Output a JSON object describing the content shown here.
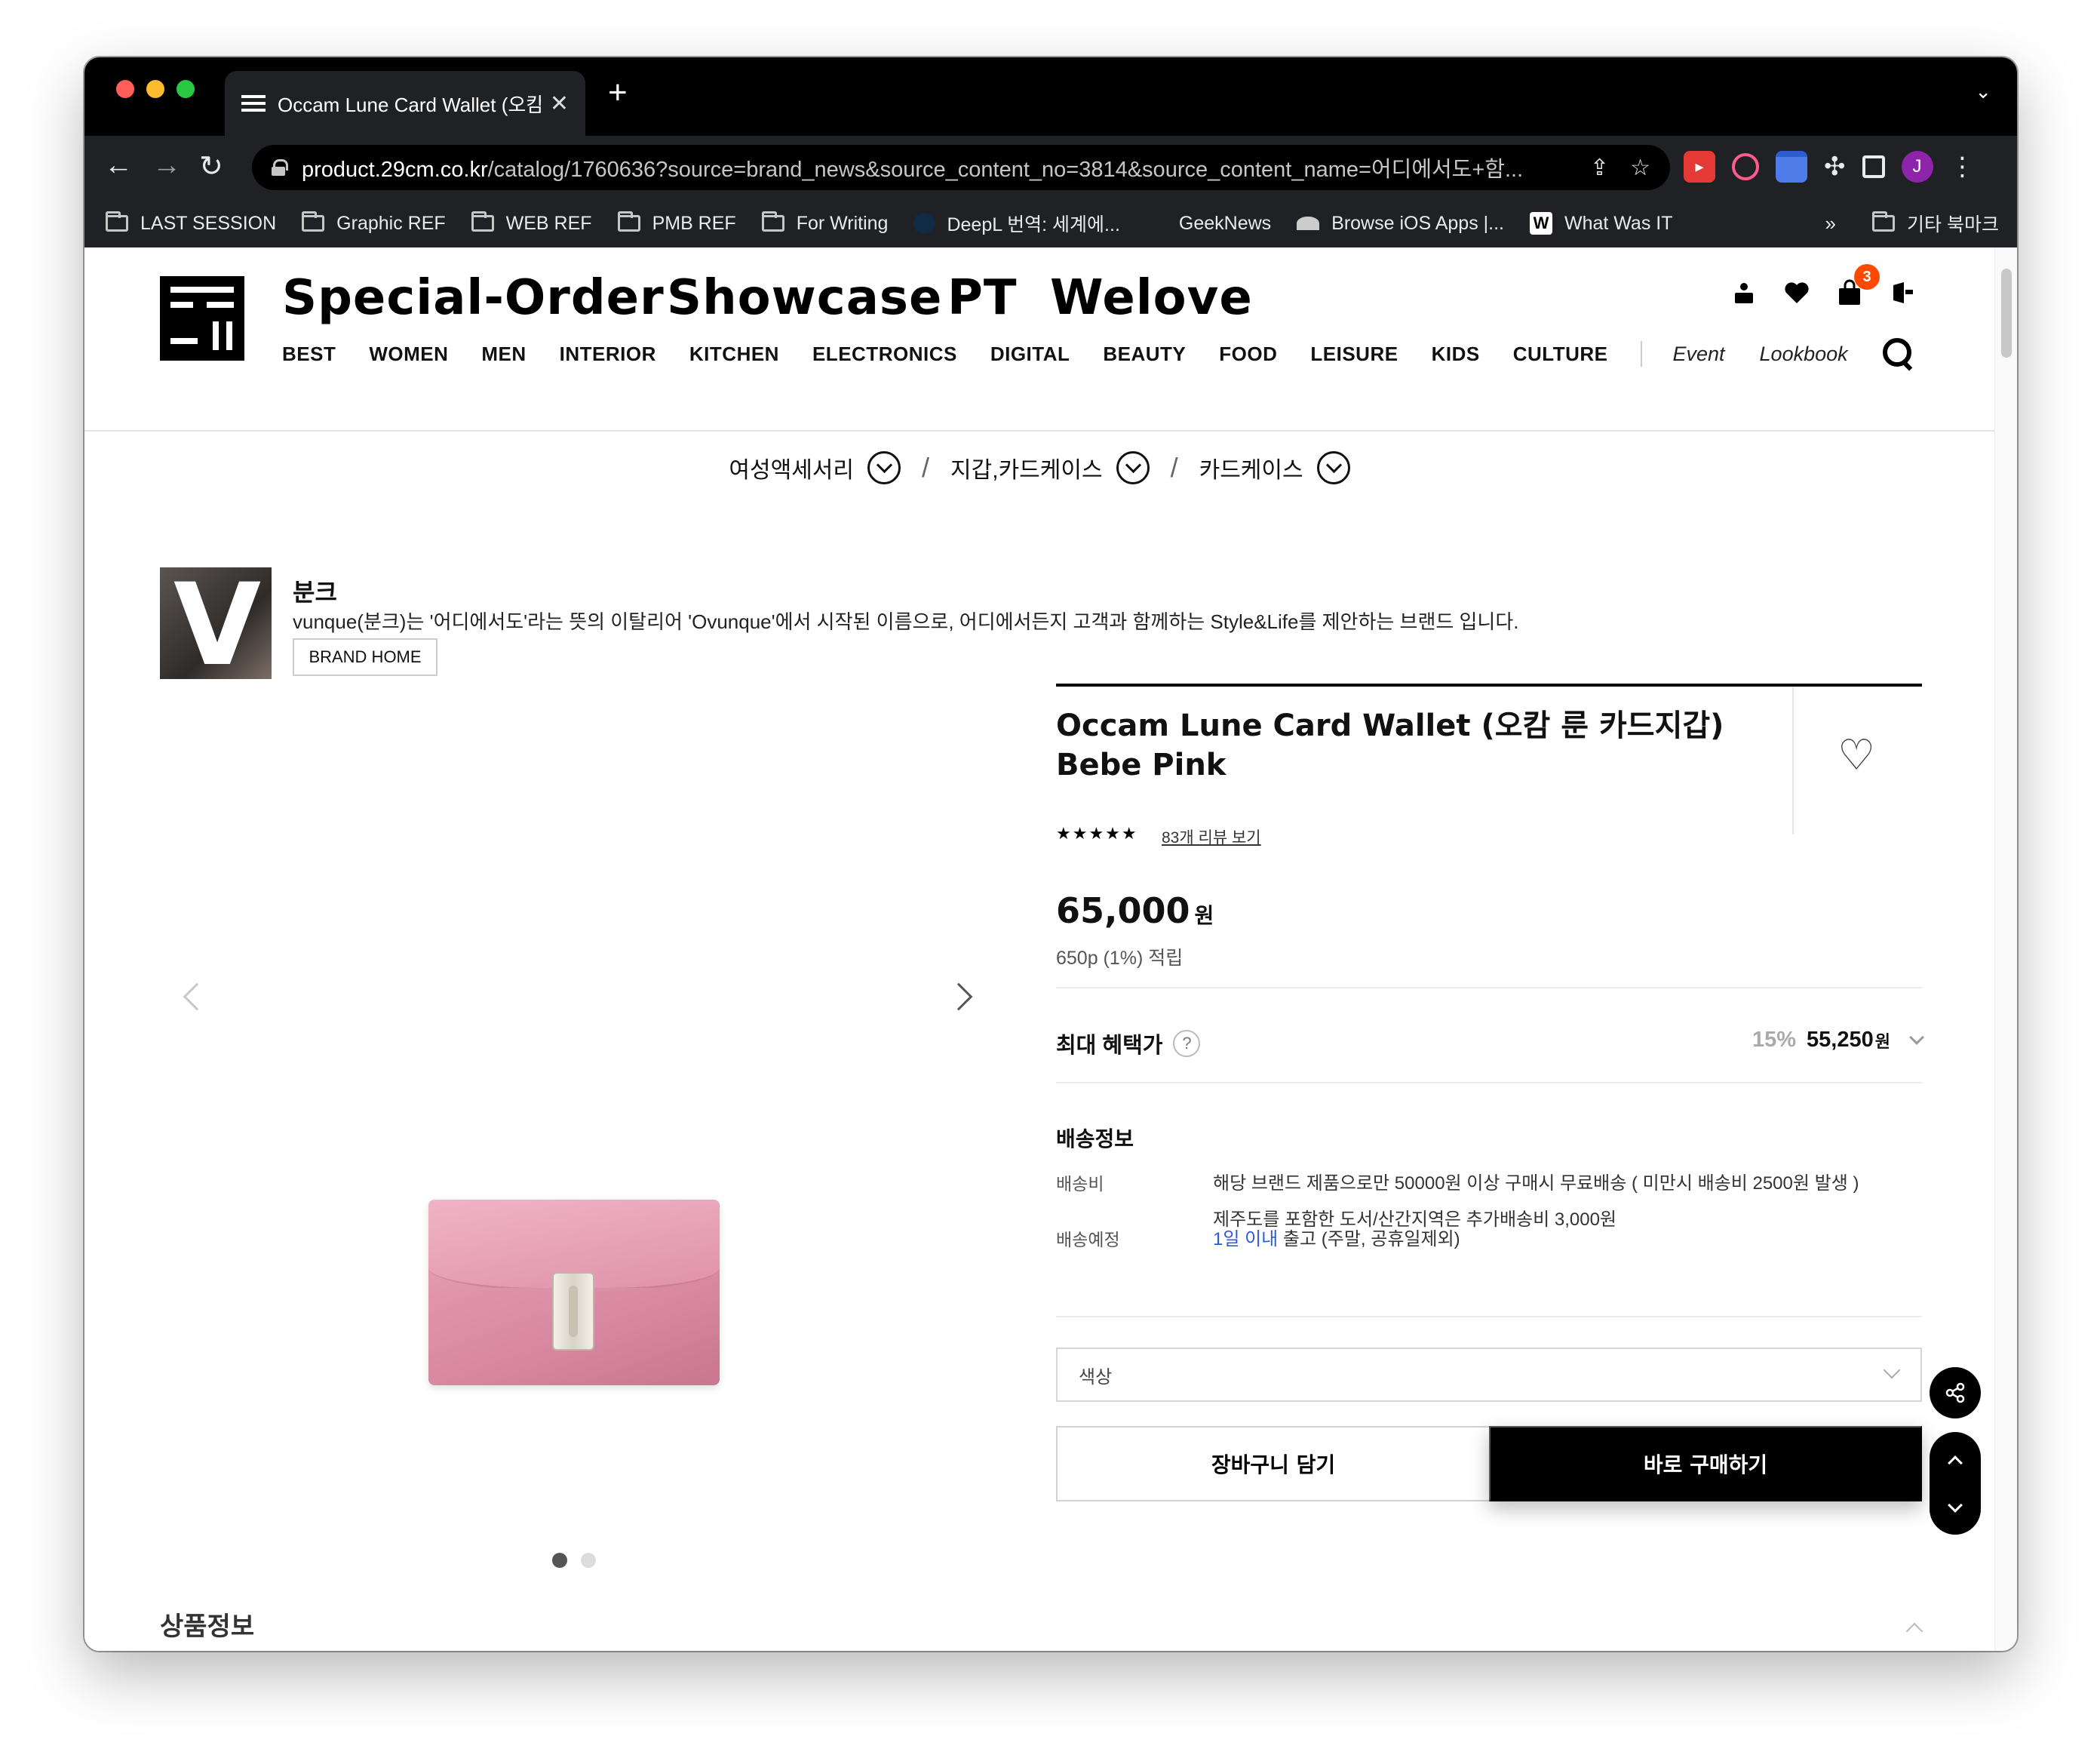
{
  "browser": {
    "tab_title": "Occam Lune Card Wallet (오캄 …",
    "tab_close": "✕",
    "new_tab": "+",
    "url_host": "product.29cm.co.kr",
    "url_path": "/catalog/1760636?source=brand_news&source_content_no=3814&source_content_name=어디에서도+함...",
    "profile_initial": "J",
    "bookmarks": [
      {
        "label": "LAST SESSION",
        "icon": "folder-icon"
      },
      {
        "label": "Graphic REF",
        "icon": "folder-icon"
      },
      {
        "label": "WEB REF",
        "icon": "folder-icon"
      },
      {
        "label": "PMB REF",
        "icon": "folder-icon"
      },
      {
        "label": "For Writing",
        "icon": "folder-icon"
      },
      {
        "label": "DeepL 번역: 세계에...",
        "icon": "deepl-icon"
      },
      {
        "label": "GeekNews",
        "icon": "geeknews-icon"
      },
      {
        "label": "Browse iOS Apps |...",
        "icon": "apps-icon"
      },
      {
        "label": "What Was IT",
        "icon": "w-icon"
      }
    ],
    "bookmarks_more": "»",
    "other_bookmarks": "기타 북마크"
  },
  "header": {
    "categories": [
      "Special-Order",
      "Showcase",
      "PT",
      "Welove"
    ],
    "nav": [
      "BEST",
      "WOMEN",
      "MEN",
      "INTERIOR",
      "KITCHEN",
      "ELECTRONICS",
      "DIGITAL",
      "BEAUTY",
      "FOOD",
      "LEISURE",
      "KIDS",
      "CULTURE"
    ],
    "nav_extra": [
      "Event",
      "Lookbook"
    ],
    "cart_count": "3"
  },
  "breadcrumbs": [
    "여성액세서리",
    "지갑,카드케이스",
    "카드케이스"
  ],
  "breadcrumb_separator": "/",
  "brand": {
    "thumb_letter": "V",
    "name": "분크",
    "description": "vunque(분크)는 '어디에서도'라는 뜻의 이탈리어 'Ovunque'에서 시작된 이름으로, 어디에서든지 고객과 함께하는 Style&Life를 제안하는 브랜드 입니다.",
    "home_button": "BRAND HOME"
  },
  "gallery": {
    "slides_total": 2,
    "active_slide": 1
  },
  "product": {
    "title": "Occam Lune Card Wallet (오캄 룬 카드지갑) Bebe Pink",
    "stars": "★★★★★",
    "review_link": "83개 리뷰 보기",
    "price": "65,000",
    "price_unit": "원",
    "points": "650p (1%) 적립",
    "benefit_label": "최대 혜택가",
    "benefit_help": "?",
    "benefit_pct": "15%",
    "benefit_price": "55,250",
    "benefit_unit": "원"
  },
  "shipping": {
    "title": "배송정보",
    "fee_label": "배송비",
    "fee_line1": "해당 브랜드 제품으로만 50000원 이상 구매시 무료배송 ( 미만시 배송비 2500원 발생 )",
    "fee_line2": "제주도를 포함한 도서/산간지역은 추가배송비 3,000원",
    "eta_label": "배송예정",
    "eta_highlight": "1일 이내",
    "eta_rest": " 출고 (주말, 공휴일제외)"
  },
  "options": {
    "color_placeholder": "색상"
  },
  "actions": {
    "cart": "장바구니 담기",
    "buy": "바로 구매하기"
  },
  "section": {
    "title": "상품정보"
  },
  "colors": {
    "accent_blue": "#2d5bd6",
    "badge_orange": "#ff4800"
  }
}
